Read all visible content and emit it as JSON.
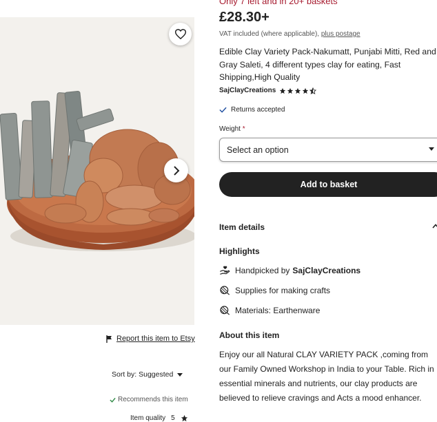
{
  "listing": {
    "stock_notice": "Only 7 left and in 20+ baskets",
    "price": "£28.30+",
    "vat_text": "VAT included (where applicable),",
    "postage_link": "plus postage",
    "title": "Edible Clay Variety Pack-Nakumatt, Punjabi Mitti, Red and Gray Saleti, 4 different types clay for eating, Fast Shipping,High Quality",
    "shop_name": "SajClayCreations",
    "rating": 4.5,
    "returns": "Returns accepted",
    "weight_label": "Weight",
    "required_mark": "*",
    "weight_select": "Select an option",
    "add_to_basket": "Add to basket"
  },
  "item_details": {
    "heading": "Item details",
    "highlights_heading": "Highlights",
    "highlights": [
      {
        "icon": "hand-heart-icon",
        "prefix": "Handpicked by",
        "bold": "SajClayCreations"
      },
      {
        "icon": "yarn-ball-icon",
        "prefix": "Supplies for making crafts",
        "bold": ""
      },
      {
        "icon": "yarn-ball-icon",
        "prefix": "Materials: Earthenware",
        "bold": ""
      }
    ],
    "about_heading": "About this item",
    "about_text": "Enjoy our all Natural CLAY VARIETY PACK ,coming from our Family Owned Workshop in India to your Table. Rich in essential minerals and nutrients, our clay products are believed to relieve cravings and Acts a mood enhancer."
  },
  "left": {
    "report_link": "Report this item to Etsy",
    "sort_label": "Sort by: Suggested",
    "recommends": "Recommends this item",
    "item_quality_label": "Item quality",
    "item_quality_value": "5"
  },
  "colors": {
    "accent_red": "#a61a2e",
    "button_dark": "#222222",
    "clay_pot": "#b8653f",
    "clay_chunks": "#c27a52",
    "gray_saleti": "#8f9592"
  }
}
